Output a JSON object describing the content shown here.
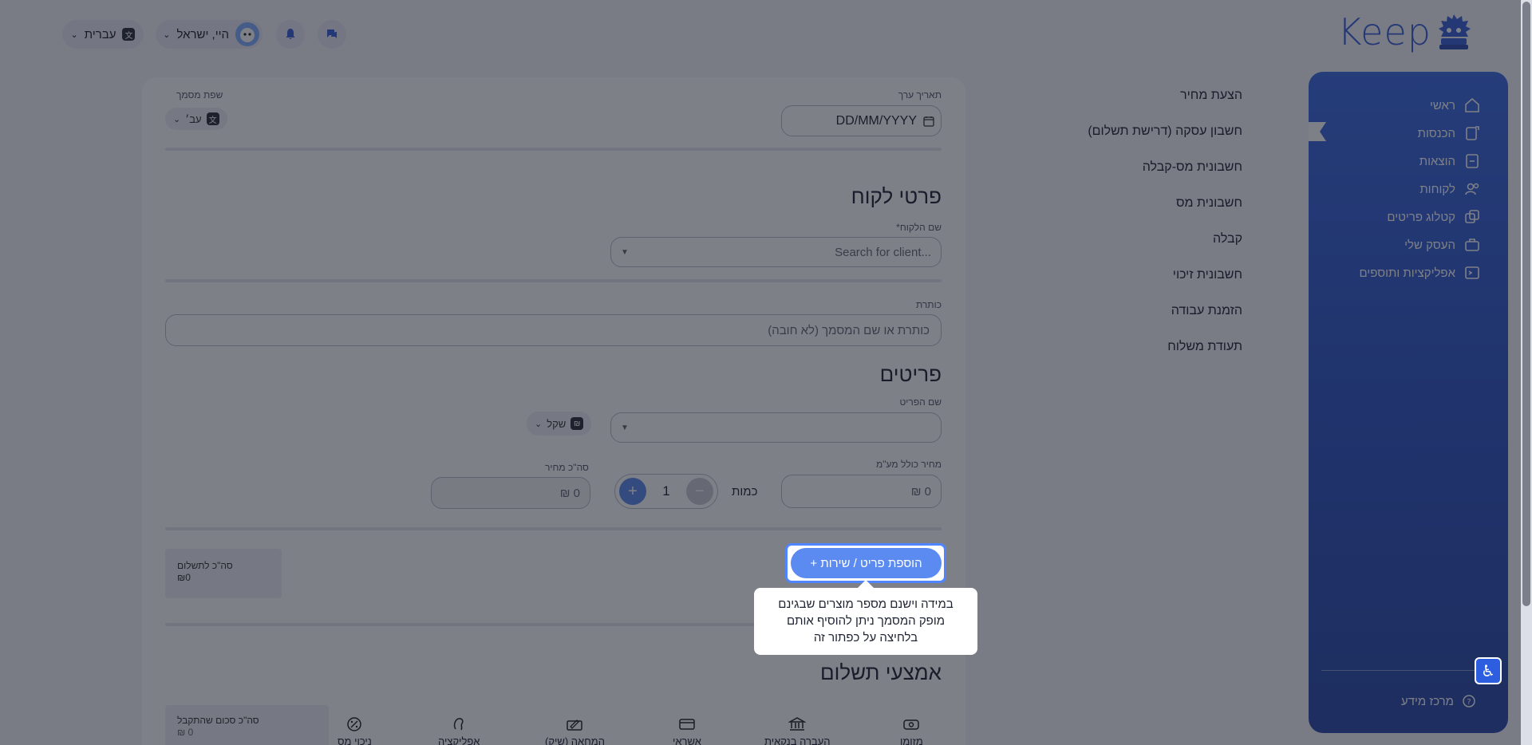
{
  "brand": {
    "logo_text": "Keep",
    "accent": "#3b5fd9"
  },
  "topbar": {
    "language_label": "עברית",
    "user_greeting": "היי, ישראל",
    "notifications_icon": "bell-icon",
    "chat_icon": "chat-icon"
  },
  "sidebar": {
    "items": [
      {
        "label": "ראשי",
        "icon": "home-icon"
      },
      {
        "label": "הכנסות",
        "icon": "income-icon"
      },
      {
        "label": "הוצאות",
        "icon": "expenses-icon"
      },
      {
        "label": "לקוחות",
        "icon": "clients-icon"
      },
      {
        "label": "קטלוג פריטים",
        "icon": "catalog-icon"
      },
      {
        "label": "העסק שלי",
        "icon": "briefcase-icon"
      },
      {
        "label": "אפליקציות ותוספים",
        "icon": "apps-icon"
      }
    ],
    "help_label": "מרכז מידע"
  },
  "doc_types": [
    "הצעת מחיר",
    "חשבון עסקה (דרישת תשלום)",
    "חשבונית מס-קבלה",
    "חשבונית מס",
    "קבלה",
    "חשבונית זיכוי",
    "הזמנת עבודה",
    "תעודת משלוח"
  ],
  "form": {
    "date_label": "תאריך ערך",
    "date_placeholder": "DD/MM/YYYY",
    "doc_language_label": "שפת מסמך",
    "doc_language_value": "עב׳",
    "customer_section_title": "פרטי לקוח",
    "customer_name_label": "*שם הלקוח",
    "customer_search_placeholder": "Search for client...",
    "title_label": "כותרת",
    "title_placeholder": "(לא חובה) כותרת או שם המסמך",
    "items_section_title": "פריטים",
    "item_name_label": "שם הפריט",
    "currency_label": "שקל",
    "currency_symbol": "₪",
    "price_label": "מחיר כולל מע\"מ",
    "price_value": "₪ 0",
    "quantity_label": "כמות",
    "quantity_value": "1",
    "line_total_label": "סה\"כ מחיר",
    "line_total_value": "₪ 0",
    "add_item_button": "+ הוספת פריט / שירות",
    "total_to_pay_label": "סה\"כ לתשלום",
    "total_to_pay_value": "₪0",
    "payment_section_title": "אמצעי תשלום",
    "total_received_label": "סה\"כ סכום שהתקבל",
    "total_received_value": "₪ 0",
    "payment_methods": [
      "מזומן",
      "העברה בנקאית",
      "אשראי",
      "המחאה (שיק)",
      "אפליקציה",
      "ניכוי מס"
    ]
  },
  "tooltip": {
    "line1": "במידה וישנם מספר מוצרים שבגינם",
    "line2": "מופק המסמך ניתן להוסיף אותם",
    "line3": "בלחיצה על כפתור זה"
  },
  "accessibility_icon": "wheelchair-icon"
}
